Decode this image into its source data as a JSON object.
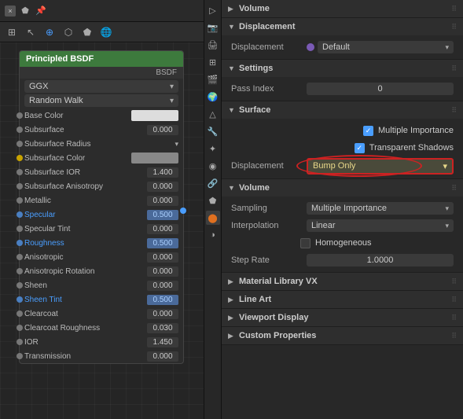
{
  "leftPanel": {
    "header": {
      "closeLabel": "×",
      "pinLabel": "📌"
    },
    "node": {
      "title": "Principled BSDF",
      "typeLabel": "BSDF",
      "dropdown1": "GGX",
      "dropdown2": "Random Walk",
      "rows": [
        {
          "label": "Base Color",
          "type": "color",
          "value": ""
        },
        {
          "label": "Subsurface",
          "type": "number",
          "value": "0.000"
        },
        {
          "label": "Subsurface Radius",
          "type": "dropdown",
          "value": ""
        },
        {
          "label": "Subsurface Color",
          "type": "color",
          "value": ""
        },
        {
          "label": "Subsurface IOR",
          "type": "number",
          "value": "1.400"
        },
        {
          "label": "Subsurface Anisotropy",
          "type": "number",
          "value": "0.000"
        },
        {
          "label": "Metallic",
          "type": "number",
          "value": "0.000"
        },
        {
          "label": "Specular",
          "type": "number",
          "value": "0.500",
          "highlight": true
        },
        {
          "label": "Specular Tint",
          "type": "number",
          "value": "0.000"
        },
        {
          "label": "Roughness",
          "type": "number",
          "value": "0.500",
          "highlight": true
        },
        {
          "label": "Anisotropic",
          "type": "number",
          "value": "0.000"
        },
        {
          "label": "Anisotropic Rotation",
          "type": "number",
          "value": "0.000"
        },
        {
          "label": "Sheen",
          "type": "number",
          "value": "0.000"
        },
        {
          "label": "Sheen Tint",
          "type": "number",
          "value": "0.500",
          "highlight": true
        },
        {
          "label": "Clearcoat",
          "type": "number",
          "value": "0.000"
        },
        {
          "label": "Clearcoat Roughness",
          "type": "number",
          "value": "0.030"
        },
        {
          "label": "IOR",
          "type": "number",
          "value": "1.450"
        },
        {
          "label": "Transmission",
          "type": "number",
          "value": "0.000"
        }
      ]
    }
  },
  "sidebar": {
    "icons": [
      {
        "name": "object-icon",
        "symbol": "△",
        "active": false
      },
      {
        "name": "modifier-icon",
        "symbol": "🔧",
        "active": false
      },
      {
        "name": "particles-icon",
        "symbol": "✦",
        "active": false
      },
      {
        "name": "physics-icon",
        "symbol": "◉",
        "active": false
      },
      {
        "name": "constraints-icon",
        "symbol": "🔗",
        "active": false
      },
      {
        "name": "object-data-icon",
        "symbol": "⬟",
        "active": false
      },
      {
        "name": "material-icon",
        "symbol": "⬤",
        "active": true
      },
      {
        "name": "shading-icon",
        "symbol": "◑",
        "active": false
      },
      {
        "name": "world-icon",
        "symbol": "🌐",
        "active": false
      },
      {
        "name": "scene-icon",
        "symbol": "📷",
        "active": false
      },
      {
        "name": "render-icon",
        "symbol": "📸",
        "active": false
      }
    ]
  },
  "rightPanel": {
    "sections": [
      {
        "id": "volume",
        "title": "Volume",
        "collapsed": false,
        "drag": "⠿"
      },
      {
        "id": "displacement",
        "title": "Displacement",
        "collapsed": false,
        "drag": "⠿",
        "props": [
          {
            "label": "Displacement",
            "type": "dropdown-with-dot",
            "dotColor": "purple",
            "value": "Default"
          }
        ]
      },
      {
        "id": "settings",
        "title": "Settings",
        "collapsed": false,
        "drag": "⠿"
      },
      {
        "id": "surface",
        "title": "Surface",
        "collapsed": false,
        "drag": "⠿",
        "checkboxes": [
          {
            "label": "Multiple Importance",
            "checked": true
          },
          {
            "label": "Transparent Shadows",
            "checked": true
          }
        ],
        "displacement": {
          "label": "Displacement",
          "value": "Bump Only",
          "hasAnnotation": true
        }
      },
      {
        "id": "volume2",
        "title": "Volume",
        "collapsed": false,
        "drag": "⠿",
        "props": [
          {
            "label": "Sampling",
            "type": "dropdown",
            "value": "Multiple Importance"
          },
          {
            "label": "Interpolation",
            "type": "dropdown",
            "value": "Linear"
          },
          {
            "label": "",
            "type": "checkbox-label",
            "checkboxLabel": "Homogeneous",
            "checked": false
          },
          {
            "label": "Step Rate",
            "type": "number",
            "value": "1.0000"
          }
        ]
      },
      {
        "id": "material-library",
        "title": "Material Library VX",
        "collapsed": true,
        "drag": "⠿"
      },
      {
        "id": "line-art",
        "title": "Line Art",
        "collapsed": true,
        "drag": "⠿"
      },
      {
        "id": "viewport-display",
        "title": "Viewport Display",
        "collapsed": true,
        "drag": "⠿"
      },
      {
        "id": "custom-properties",
        "title": "Custom Properties",
        "collapsed": true,
        "drag": "⠿"
      }
    ],
    "settings": {
      "passIndex": {
        "label": "Pass Index",
        "value": "0"
      }
    }
  }
}
